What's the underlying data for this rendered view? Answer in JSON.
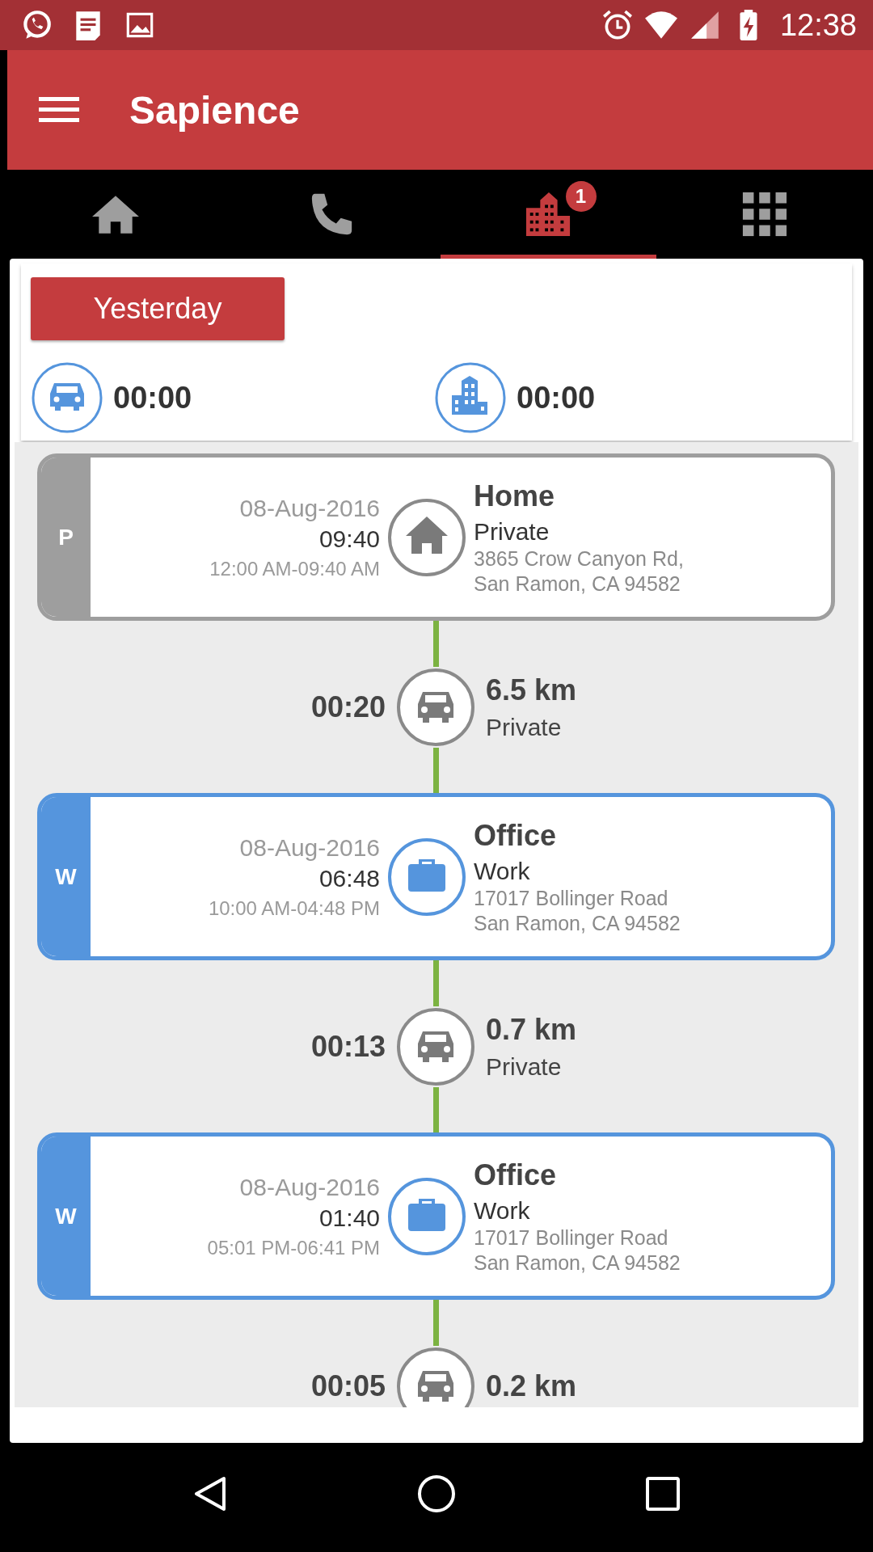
{
  "status_bar": {
    "time": "12:38"
  },
  "app_bar": {
    "title": "Sapience"
  },
  "tabs": [
    {
      "selected": false
    },
    {
      "selected": false
    },
    {
      "selected": true,
      "badge": "1"
    },
    {
      "selected": false
    }
  ],
  "summary": {
    "button": "Yesterday",
    "stats": [
      {
        "kind": "drive",
        "value": "00:00"
      },
      {
        "kind": "office",
        "value": "00:00"
      }
    ]
  },
  "timeline": [
    {
      "kind": "home",
      "tag": "P",
      "color": "#9e9e9e",
      "date": "08-Aug-2016",
      "duration": "09:40",
      "range": "12:00 AM-09:40 AM",
      "name": "Home",
      "category": "Private",
      "address": [
        "3865 Crow Canyon Rd,",
        "San Ramon, CA 94582"
      ]
    },
    {
      "kind": "trip",
      "duration": "00:20",
      "distance": "6.5 km",
      "mode": "Private"
    },
    {
      "kind": "office",
      "tag": "W",
      "color": "#5595dd",
      "date": "08-Aug-2016",
      "duration": "06:48",
      "range": "10:00 AM-04:48 PM",
      "name": "Office",
      "category": "Work",
      "address": [
        "17017 Bollinger Road",
        "San Ramon, CA 94582"
      ]
    },
    {
      "kind": "trip",
      "duration": "00:13",
      "distance": "0.7 km",
      "mode": "Private"
    },
    {
      "kind": "office",
      "tag": "W",
      "color": "#5595dd",
      "date": "08-Aug-2016",
      "duration": "01:40",
      "range": "05:01 PM-06:41 PM",
      "name": "Office",
      "category": "Work",
      "address": [
        "17017 Bollinger Road",
        "San Ramon, CA 94582"
      ]
    },
    {
      "kind": "trip",
      "duration": "00:05",
      "distance": "0.2 km"
    }
  ]
}
